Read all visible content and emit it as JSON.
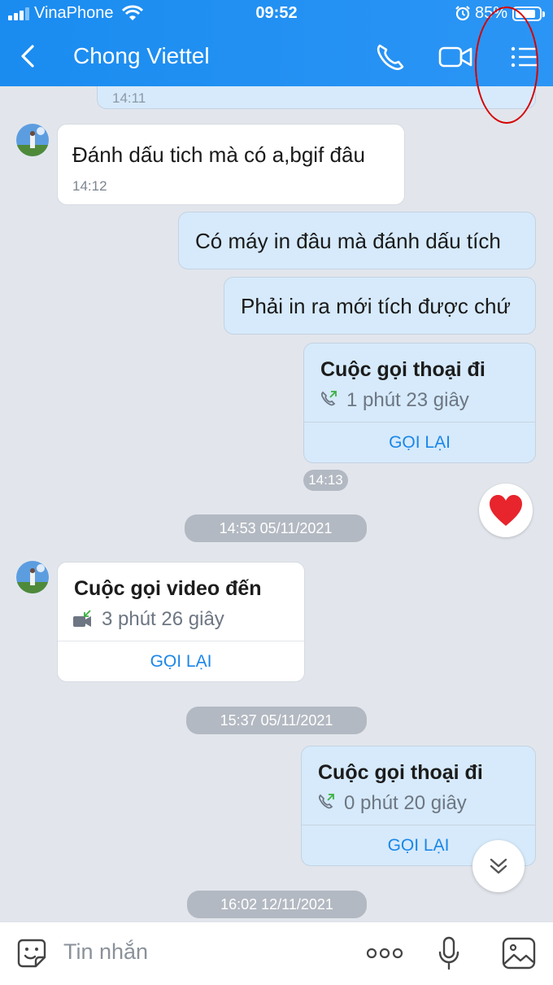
{
  "status_bar": {
    "carrier": "VinaPhone",
    "time": "09:52",
    "battery": "85%",
    "battery_level": 0.85
  },
  "header": {
    "title": "Chong Viettel"
  },
  "messages": [
    {
      "time": "14:11"
    },
    {
      "text": "Đánh dấu tich mà có a,bgif đâu",
      "time": "14:12"
    },
    {
      "text": "Có máy in đâu mà đánh dấu tích"
    },
    {
      "text": "Phải in ra mới tích được chứ"
    }
  ],
  "calls": [
    {
      "title": "Cuộc gọi thoại đi",
      "duration": "1 phút 23 giây",
      "action": "GỌI LẠI",
      "time": "14:13"
    },
    {
      "title": "Cuộc gọi video đến",
      "duration": "3 phút 26 giây",
      "action": "GỌI LẠI"
    },
    {
      "title": "Cuộc gọi thoại đi",
      "duration": "0 phút 20 giây",
      "action": "GỌI LẠI"
    }
  ],
  "dividers": [
    "14:53 05/11/2021",
    "15:37 05/11/2021",
    "16:02 12/11/2021"
  ],
  "reaction": "heart",
  "input": {
    "placeholder": "Tin nhắn"
  },
  "icons": [
    "back-icon",
    "phone-icon",
    "video-icon",
    "menu-icon",
    "sticker-icon",
    "more-icon",
    "mic-icon",
    "image-icon",
    "heart-icon",
    "chevron-down-icon"
  ],
  "colors": {
    "header": "#1a8cf0",
    "my_bubble": "#d6eafb",
    "accent": "#1a86e8",
    "highlight_circle": "#d60000"
  }
}
